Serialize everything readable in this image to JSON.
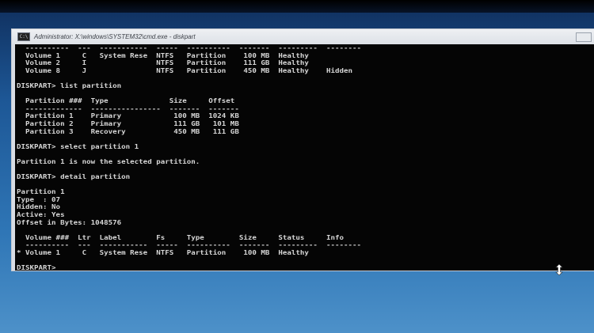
{
  "window": {
    "title": "Administrator: X:\\windows\\SYSTEM32\\cmd.exe - diskpart",
    "icon_label": "C:\\"
  },
  "console": {
    "lines": [
      "  ----------  ---  -----------  -----  ----------  -------  ---------  --------",
      "  Volume 1     C   System Rese  NTFS   Partition    100 MB  Healthy",
      "  Volume 2     I                NTFS   Partition    111 GB  Healthy",
      "  Volume 8     J                NTFS   Partition    450 MB  Healthy    Hidden",
      "",
      "DISKPART> list partition",
      "",
      "  Partition ###  Type              Size     Offset",
      "  -------------  ----------------  -------  -------",
      "  Partition 1    Primary            100 MB  1024 KB",
      "  Partition 2    Primary            111 GB   101 MB",
      "  Partition 3    Recovery           450 MB   111 GB",
      "",
      "DISKPART> select partition 1",
      "",
      "Partition 1 is now the selected partition.",
      "",
      "DISKPART> detail partition",
      "",
      "Partition 1",
      "Type  : 07",
      "Hidden: No",
      "Active: Yes",
      "Offset in Bytes: 1048576",
      "",
      "  Volume ###  Ltr  Label        Fs     Type        Size     Status     Info",
      "  ----------  ---  -----------  -----  ----------  -------  ---------  --------",
      "* Volume 1     C   System Rese  NTFS   Partition    100 MB  Healthy",
      "",
      "DISKPART>"
    ]
  }
}
